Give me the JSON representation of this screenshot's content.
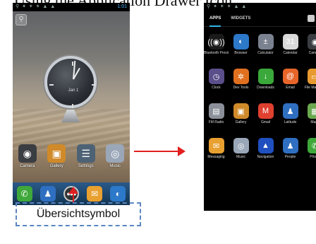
{
  "caption": "Using the Application Drawer Icon",
  "left_phone": {
    "status_time": "1:01",
    "clock_date": "Jan 1",
    "home_apps": [
      {
        "label": "Camera",
        "icon": "camera-icon",
        "glyph": "◉",
        "color": "#3a3d42"
      },
      {
        "label": "Gallery",
        "icon": "gallery-icon",
        "glyph": "▣",
        "color": "#d08a2a"
      },
      {
        "label": "Settings",
        "icon": "settings-icon",
        "glyph": "☰",
        "color": "#4d6275"
      },
      {
        "label": "Music",
        "icon": "music-icon",
        "glyph": "◎",
        "color": "#9aa7b8"
      }
    ],
    "dock": [
      {
        "icon": "phone-icon",
        "glyph": "✆",
        "color": "#3fa83a"
      },
      {
        "icon": "contacts-icon",
        "glyph": "♟",
        "color": "#2f6fc2"
      },
      {
        "icon": "app-drawer-icon",
        "glyph": "●●●",
        "color": "#333333"
      },
      {
        "icon": "messaging-icon",
        "glyph": "✉",
        "color": "#e8a030"
      },
      {
        "icon": "browser-icon",
        "glyph": "◐",
        "color": "#2c78c9"
      }
    ]
  },
  "callout_label": "Übersichtsymbol",
  "right_phone": {
    "tabs": [
      "APPS",
      "WIDGETS"
    ],
    "apps": [
      {
        "label": "Bluetooth Proximity",
        "icon": "bluetooth-icon",
        "glyph": "((◉))",
        "color": "#1a1a1a"
      },
      {
        "label": "Browser",
        "icon": "browser-icon",
        "glyph": "◐",
        "color": "#2c78c9"
      },
      {
        "label": "Calculator",
        "icon": "calculator-icon",
        "glyph": "±",
        "color": "#7a8290"
      },
      {
        "label": "Calendar",
        "icon": "calendar-icon",
        "glyph": "31",
        "color": "#d9d9d9"
      },
      {
        "label": "Camera",
        "icon": "camera-icon",
        "glyph": "◉",
        "color": "#3a3d42"
      },
      {
        "label": "Clock",
        "icon": "clock-icon",
        "glyph": "◷",
        "color": "#5a4f8a"
      },
      {
        "label": "Dev Tools",
        "icon": "devtools-icon",
        "glyph": "✲",
        "color": "#e07020"
      },
      {
        "label": "Downloads",
        "icon": "downloads-icon",
        "glyph": "↓",
        "color": "#3aa83a"
      },
      {
        "label": "Email",
        "icon": "email-icon",
        "glyph": "@",
        "color": "#e8652a"
      },
      {
        "label": "File Manager",
        "icon": "folder-icon",
        "glyph": "▭",
        "color": "#e89a30"
      },
      {
        "label": "FM Radio",
        "icon": "radio-icon",
        "glyph": "▤",
        "color": "#8a8f99"
      },
      {
        "label": "Gallery",
        "icon": "gallery-icon",
        "glyph": "▣",
        "color": "#d08a2a"
      },
      {
        "label": "Gmail",
        "icon": "gmail-icon",
        "glyph": "M",
        "color": "#e04030"
      },
      {
        "label": "Latitude",
        "icon": "latitude-icon",
        "glyph": "♟",
        "color": "#2f6fc2"
      },
      {
        "label": "Maps",
        "icon": "maps-icon",
        "glyph": "▦",
        "color": "#6aa84f"
      },
      {
        "label": "Messaging",
        "icon": "messaging-icon",
        "glyph": "✉",
        "color": "#e8a030"
      },
      {
        "label": "Music",
        "icon": "music-icon",
        "glyph": "◎",
        "color": "#9aa7b8"
      },
      {
        "label": "Navigation",
        "icon": "navigation-icon",
        "glyph": "▲",
        "color": "#2050c0"
      },
      {
        "label": "People",
        "icon": "people-icon",
        "glyph": "♟",
        "color": "#2f6fc2"
      },
      {
        "label": "Phone",
        "icon": "phone-icon",
        "glyph": "✆",
        "color": "#3fa83a"
      }
    ]
  }
}
